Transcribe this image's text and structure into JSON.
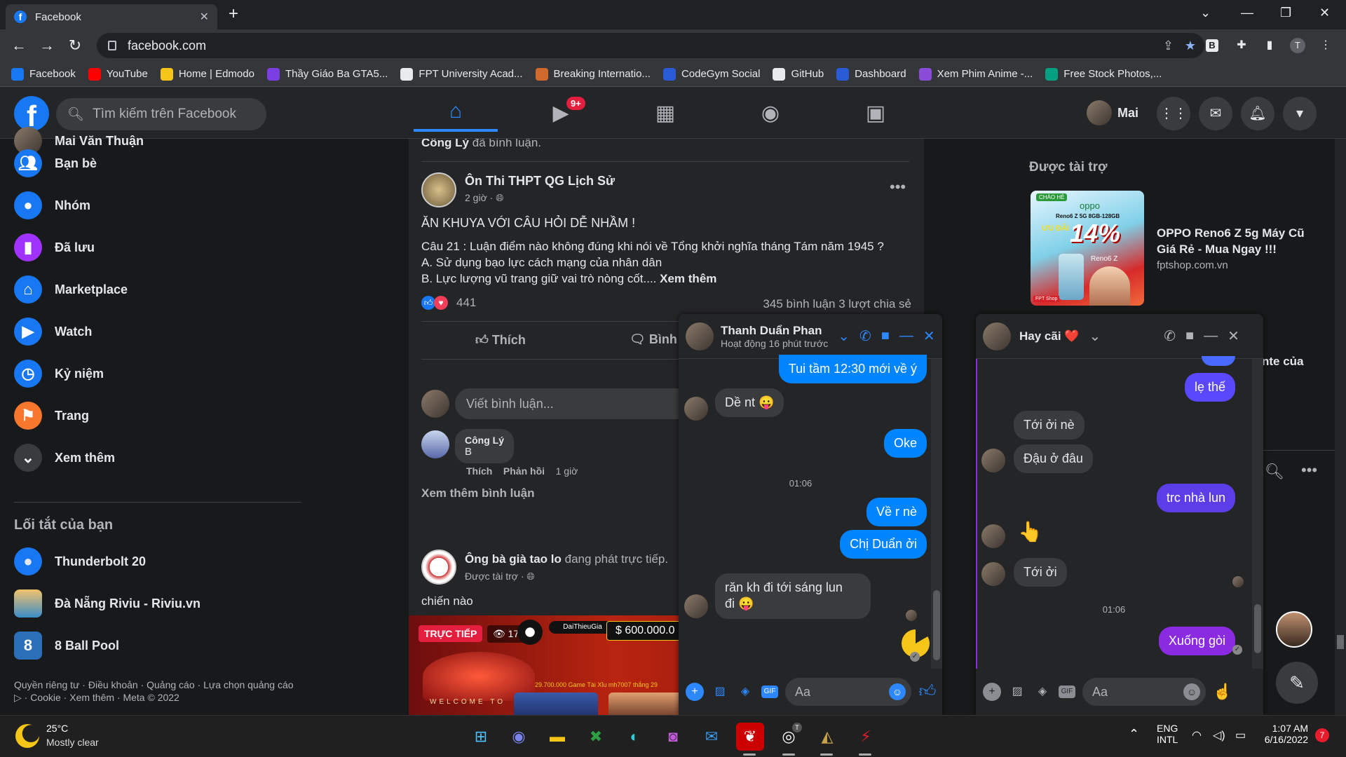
{
  "browser": {
    "tab_title": "Facebook",
    "url": "facebook.com",
    "bookmarks": [
      {
        "label": "Facebook",
        "color": "#1877f2"
      },
      {
        "label": "YouTube",
        "color": "#ff0000"
      },
      {
        "label": "Home | Edmodo",
        "color": "#f5c518"
      },
      {
        "label": "Thầy Giáo Ba GTA5...",
        "color": "#7b3fe4"
      },
      {
        "label": "FPT University Acad...",
        "color": "#e8eaed"
      },
      {
        "label": "Breaking Internatio...",
        "color": "#d06a2c"
      },
      {
        "label": "CodeGym Social",
        "color": "#2a5bd7"
      },
      {
        "label": "GitHub",
        "color": "#e8eaed"
      },
      {
        "label": "Dashboard",
        "color": "#2a5bd7"
      },
      {
        "label": "Xem Phim Anime -...",
        "color": "#8a4cd8"
      },
      {
        "label": "Free Stock Photos,...",
        "color": "#05a081"
      }
    ],
    "profile_initial": "T",
    "ext_b": "B"
  },
  "fb": {
    "logo": "f",
    "search_placeholder": "Tìm kiếm trên Facebook",
    "notif_badge": "9+",
    "profile_name": "Mai"
  },
  "leftnav": {
    "cut_name": "Mai Văn Thuận",
    "items": [
      {
        "label": "Bạn bè",
        "icon": "friends-icon",
        "color": "#1877f2"
      },
      {
        "label": "Nhóm",
        "icon": "groups-icon",
        "color": "#1877f2"
      },
      {
        "label": "Đã lưu",
        "icon": "saved-icon",
        "color": "#a033ff"
      },
      {
        "label": "Marketplace",
        "icon": "marketplace-icon",
        "color": "#1877f2"
      },
      {
        "label": "Watch",
        "icon": "watch-icon",
        "color": "#1877f2"
      },
      {
        "label": "Kỷ niệm",
        "icon": "memories-icon",
        "color": "#1877f2"
      },
      {
        "label": "Trang",
        "icon": "pages-icon",
        "color": "#f7782c"
      },
      {
        "label": "Xem thêm",
        "icon": "chevron-down-icon",
        "color": "#3a3b3c"
      }
    ],
    "shortcuts_title": "Lối tắt của bạn",
    "shortcuts": [
      {
        "label": "Thunderbolt 20"
      },
      {
        "label": "Đà Nẵng Riviu - Riviu.vn"
      },
      {
        "label": "8 Ball Pool"
      }
    ],
    "footer": "Quyền riêng tư · Điều khoản · Quảng cáo · Lựa chọn quảng cáo ▷ · Cookie · Xem thêm · Meta © 2022"
  },
  "post1": {
    "top_comment_name": "Công Lý",
    "top_comment_text": "đã bình luận.",
    "author": "Ôn Thi THPT QG Lịch Sử",
    "time": "2 giờ ·",
    "headline": "ĂN KHUYA VỚI CÂU HỎI DỄ NHẦM !",
    "line1": "Câu 21 : Luận điểm nào không đúng khi nói về Tổng khởi nghĩa tháng Tám năm 1945 ?",
    "line2": "A. Sử dụng bạo lực cách mạng của nhân dân",
    "line3": "B. Lực lượng vũ trang giữ vai trò nòng cốt....",
    "see_more": "Xem thêm",
    "reactions": "441",
    "comments": "345 bình luận",
    "shares": "3 lượt chia sẻ",
    "like": "Thích",
    "comment": "Bình",
    "comment_placeholder": "Viết bình luận...",
    "c_name": "Công Lý",
    "c_text": "B",
    "c_like": "Thích",
    "c_reply": "Phản hồi",
    "c_time": "1 giờ",
    "more_comments": "Xem thêm bình luận"
  },
  "post2": {
    "author": "Ông bà già tao lo",
    "action": "đang phát trực tiếp.",
    "sub": "Được tài trợ ·",
    "text": "chiến nào",
    "live": "TRỰC TIẾP",
    "viewers": "175",
    "amount": "600.000.0",
    "banner": "WELCOME TO",
    "game1": "29.700.000 Game Tài Xỉu",
    "game2": "mh7007 thắng 29",
    "chip": "DaiThieuGia"
  },
  "right": {
    "sponsored_title": "Được tài trợ",
    "ad_title": "OPPO Reno6 Z 5g Máy Cũ Giá Rẻ - Mua Ngay !!!",
    "ad_domain": "fptshop.com.vn",
    "cut_text": "nte của",
    "ad_brand": "oppo",
    "ad_pct": "14%",
    "ad_model": "Reno6 Z 5G 8GB-128GB",
    "ad_hello": "CHÀO HÈ",
    "ad_promo": "ƯU ĐÃI",
    "ad_model2": "Reno6 Z",
    "ad_shop": "FPT Shop"
  },
  "chat1": {
    "name": "Thanh Duẩn Phan",
    "status": "Hoạt động 16 phút trước",
    "m1": "Tui tầm 12:30 mới về ý",
    "m2": "Dề nt 😛",
    "m3": "Oke",
    "time": "01:06",
    "m4": "Về r nè",
    "m5": "Chị Duẩn ởi",
    "m6a": "răn kh đi tới sáng lun",
    "m6b": "đi 😛",
    "input": "Aa"
  },
  "chat2": {
    "name": "Hay cãi",
    "heart": "❤️",
    "m1": "lẹ thế",
    "m2": "Tới ởi nè",
    "m3": "Đậu ở đâu",
    "m4": "trc nhà lun",
    "m5": "👆",
    "m6": "Tới ởi",
    "time": "01:06",
    "m7": "Xuống gòi",
    "input": "Aa"
  },
  "taskbar": {
    "temp": "25°C",
    "weather": "Mostly clear",
    "lang1": "ENG",
    "lang2": "INTL",
    "time": "1:07 AM",
    "date": "6/16/2022",
    "notif": "7",
    "chrome_badge": "T"
  }
}
